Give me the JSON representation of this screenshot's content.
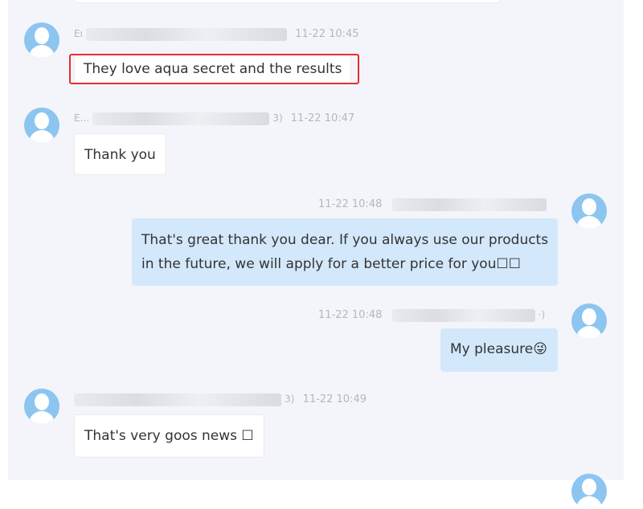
{
  "messages": [
    {
      "direction": "incoming",
      "sender_visible": "Eı",
      "sender_tail": "",
      "time": "11-22 10:45",
      "text": "They love aqua secret and the results",
      "highlighted": true
    },
    {
      "direction": "incoming",
      "sender_visible": "E...",
      "sender_tail": "3)",
      "time": "11-22 10:47",
      "text": "Thank you"
    },
    {
      "direction": "outgoing",
      "sender_visible": "",
      "sender_tail": "",
      "time": "11-22 10:48",
      "text_lines": [
        "That's great thank you dear. If you always use our products",
        "in the future, we will apply for a better price for you☐☐"
      ]
    },
    {
      "direction": "outgoing",
      "sender_visible": "",
      "sender_tail": "·)",
      "time": "11-22 10:48",
      "text": "My pleasure😜"
    },
    {
      "direction": "incoming",
      "sender_visible": "",
      "sender_tail": "3)",
      "time": "11-22 10:49",
      "text": "That's very goos news ☐"
    }
  ],
  "avatar_icon": "user-avatar-icon",
  "colors": {
    "panel_background": "#f4f5fa",
    "outgoing_bubble": "#d3e8fb",
    "incoming_bubble": "#ffffff",
    "avatar": "#8cc5f0",
    "highlight": "#e53030",
    "meta_text": "#b3b7c2"
  }
}
